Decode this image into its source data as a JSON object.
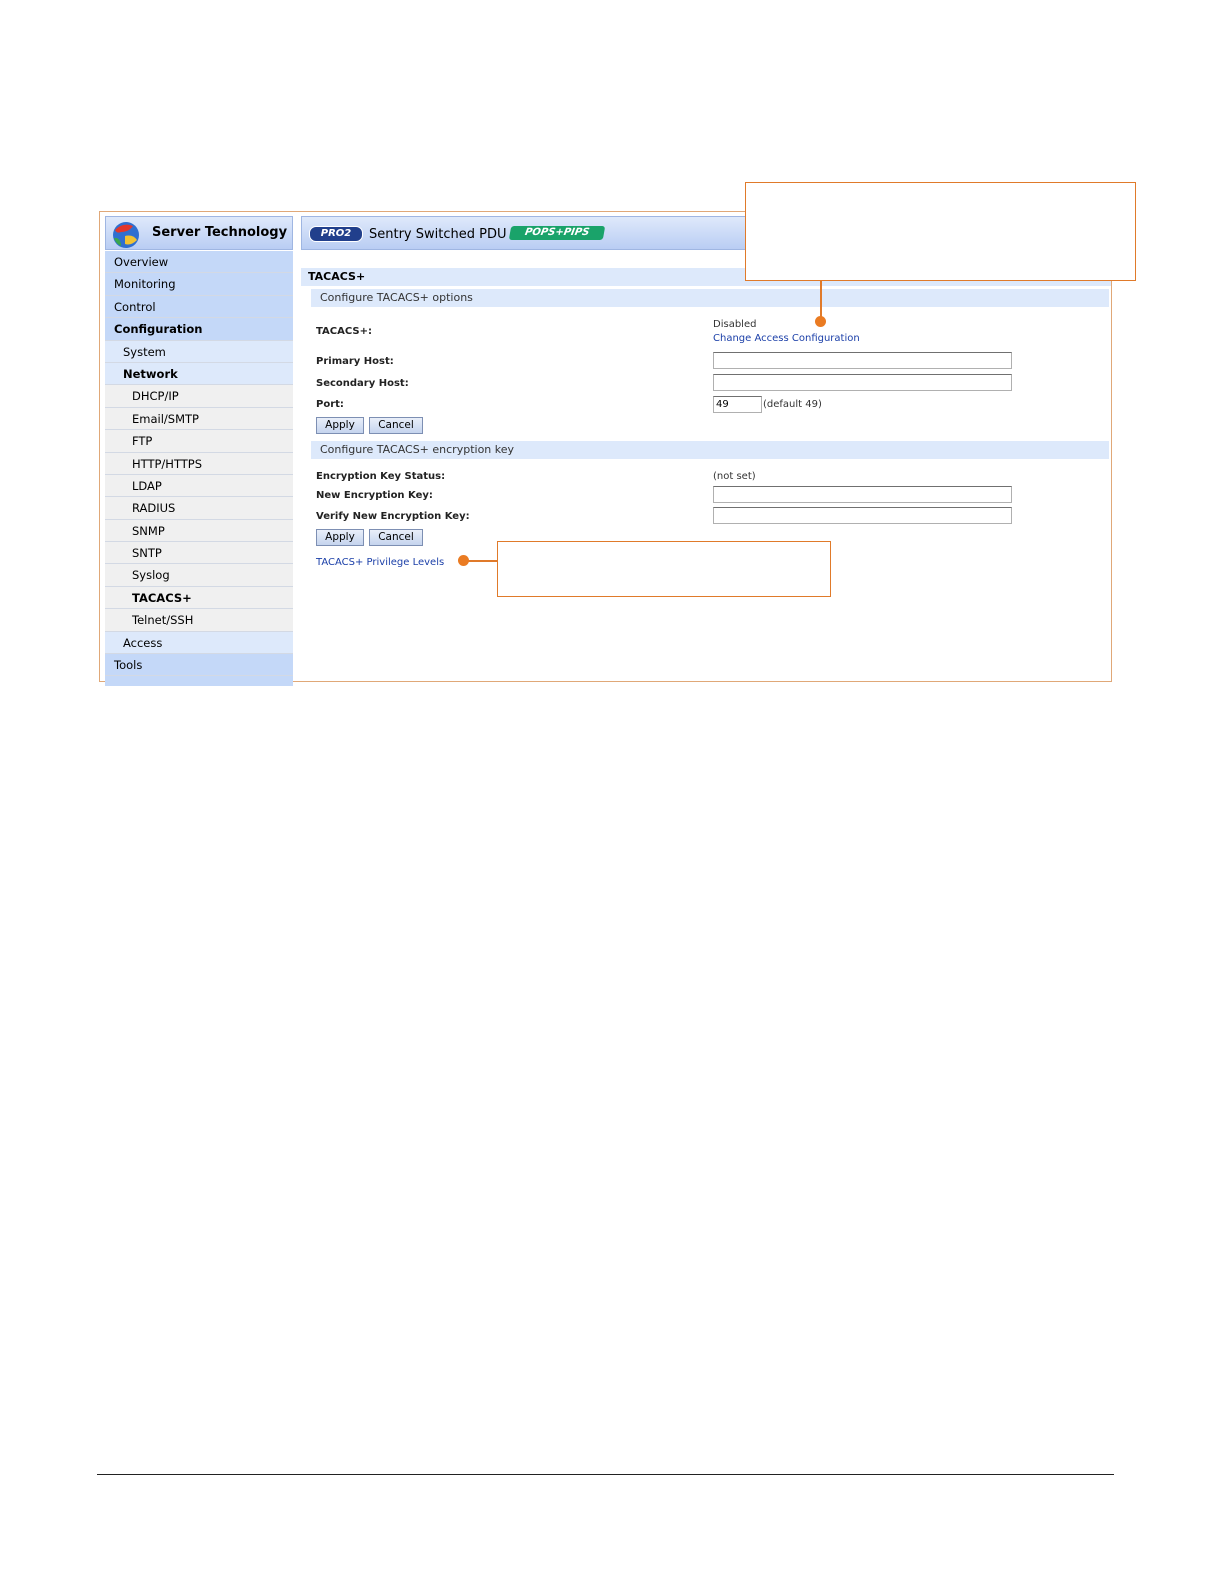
{
  "logo": {
    "text": "Server Technology"
  },
  "header": {
    "pro_badge": "PRO2",
    "product_title": "Sentry Switched PDU",
    "pops_badge": "POPS+PIPS"
  },
  "nav": {
    "overview": "Overview",
    "monitoring": "Monitoring",
    "control": "Control",
    "configuration": "Configuration",
    "system": "System",
    "network": "Network",
    "dhcp": "DHCP/IP",
    "email": "Email/SMTP",
    "ftp": "FTP",
    "http": "HTTP/HTTPS",
    "ldap": "LDAP",
    "radius": "RADIUS",
    "snmp": "SNMP",
    "sntp": "SNTP",
    "syslog": "Syslog",
    "tacacs": "TACACS+",
    "telnet": "Telnet/SSH",
    "access": "Access",
    "tools": "Tools"
  },
  "page": {
    "title": "TACACS+"
  },
  "options": {
    "header": "Configure TACACS+ options",
    "tacacs_label": "TACACS+:",
    "tacacs_status": "Disabled",
    "change_link": "Change Access Configuration",
    "primary_label": "Primary Host:",
    "primary_value": "",
    "secondary_label": "Secondary Host:",
    "secondary_value": "",
    "port_label": "Port:",
    "port_value": "49",
    "port_default": "(default 49)",
    "apply": "Apply",
    "cancel": "Cancel"
  },
  "encryption": {
    "header": "Configure TACACS+ encryption key",
    "status_label": "Encryption Key Status:",
    "status_value": "(not set)",
    "new_label": "New Encryption Key:",
    "verify_label": "Verify New Encryption Key:",
    "apply": "Apply",
    "cancel": "Cancel"
  },
  "privilege_link": "TACACS+ Privilege Levels",
  "colors": {
    "callout": "#e07a2a",
    "link": "#1b3fa8",
    "section_bg": "#dde9fb",
    "nav_bg": "#c4d8f8"
  }
}
